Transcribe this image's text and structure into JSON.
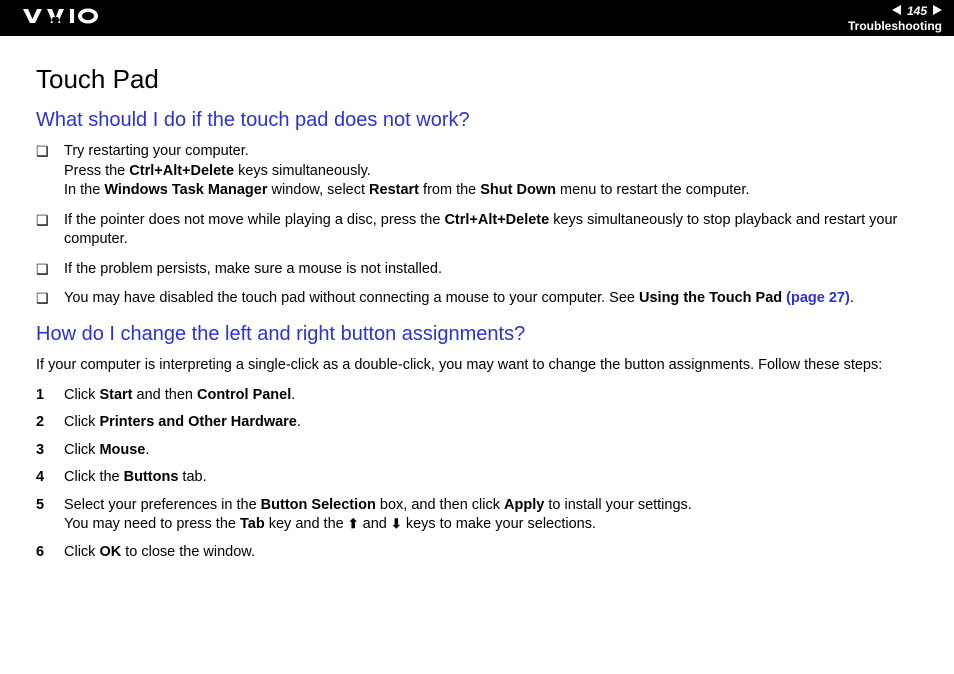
{
  "header": {
    "page_number": "145",
    "breadcrumb": "Troubleshooting"
  },
  "title": "Touch Pad",
  "section1": {
    "heading": "What should I do if the touch pad does not work?",
    "bullets": [
      {
        "l1": "Try restarting your computer.",
        "l2a": "Press the ",
        "l2b": "Ctrl+Alt+Delete",
        "l2c": " keys simultaneously.",
        "l3a": "In the ",
        "l3b": "Windows Task Manager",
        "l3c": " window, select ",
        "l3d": "Restart",
        "l3e": " from the ",
        "l3f": "Shut Down",
        "l3g": " menu to restart the computer."
      },
      {
        "a": "If the pointer does not move while playing a disc, press the ",
        "b": "Ctrl+Alt+Delete",
        "c": " keys simultaneously to stop playback and restart your computer."
      },
      {
        "a": "If the problem persists, make sure a mouse is not installed."
      },
      {
        "a": "You may have disabled the touch pad without connecting a mouse to your computer. See ",
        "b": "Using the Touch Pad ",
        "c": "(page 27)",
        "d": "."
      }
    ]
  },
  "section2": {
    "heading": "How do I change the left and right button assignments?",
    "intro": "If your computer is interpreting a single-click as a double-click, you may want to change the button assignments. Follow these steps:",
    "steps": [
      {
        "n": "1",
        "a": "Click ",
        "b": "Start",
        "c": " and then ",
        "d": "Control Panel",
        "e": "."
      },
      {
        "n": "2",
        "a": "Click ",
        "b": "Printers and Other Hardware",
        "c": "."
      },
      {
        "n": "3",
        "a": "Click ",
        "b": "Mouse",
        "c": "."
      },
      {
        "n": "4",
        "a": "Click the ",
        "b": "Buttons",
        "c": " tab."
      },
      {
        "n": "5",
        "a": "Select your preferences in the ",
        "b": "Button Selection",
        "c": " box, and then click ",
        "d": "Apply",
        "e": " to install your settings.",
        "f": "You may need to press the ",
        "g": "Tab",
        "h": " key and the ",
        "up": "⬆",
        "i": " and ",
        "down": "⬇",
        "j": " keys to make your selections."
      },
      {
        "n": "6",
        "a": "Click ",
        "b": "OK",
        "c": " to close the window."
      }
    ]
  }
}
